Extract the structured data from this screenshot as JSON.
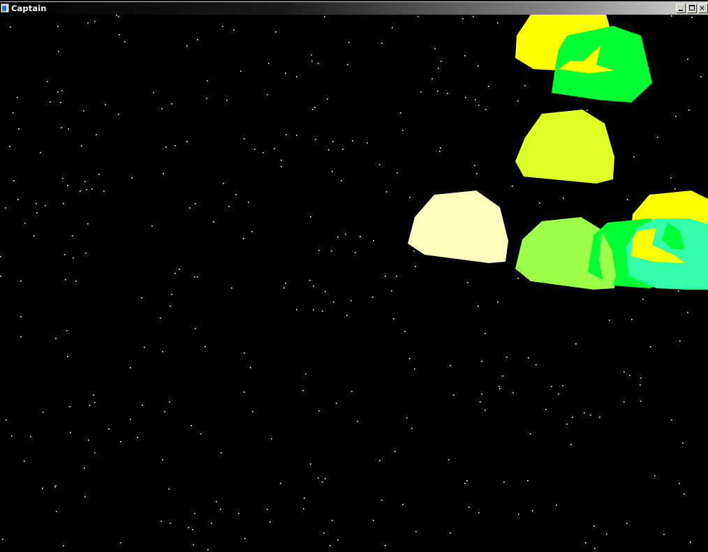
{
  "window": {
    "title": "Captain",
    "controls": {
      "minimize": "minimize",
      "maximize": "maximize",
      "close": "close"
    }
  },
  "scene": {
    "background_color": "#000000",
    "star_color": "#ffffff",
    "blob_colors": {
      "yellow": "#ffff00",
      "green": "#00ff33",
      "chartreuse": "#e0ff26",
      "cream": "#ffffc0",
      "light_green": "#9cff4a",
      "aqua": "#33ffaa"
    }
  }
}
